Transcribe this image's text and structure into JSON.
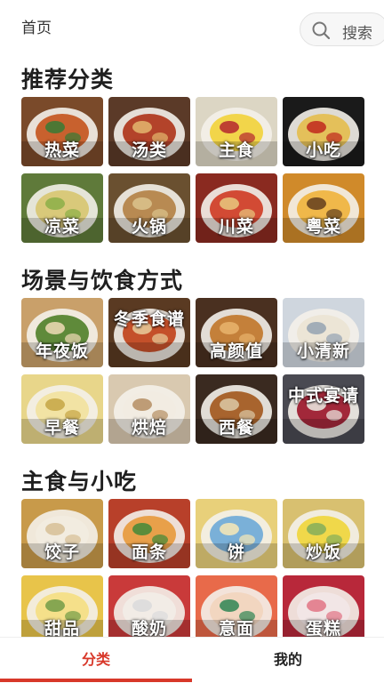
{
  "header": {
    "home_label": "首页",
    "search_label": "搜索",
    "search_icon": "search-icon"
  },
  "sections": [
    {
      "title": "推荐分类",
      "items": [
        {
          "label": "热菜",
          "colors": [
            "#7a4a2a",
            "#c8612e",
            "#3f7a35"
          ]
        },
        {
          "label": "汤类",
          "colors": [
            "#5b3a28",
            "#b3432a",
            "#e0b06a"
          ]
        },
        {
          "label": "主食",
          "colors": [
            "#dcd6c4",
            "#f2d54a",
            "#b83030"
          ]
        },
        {
          "label": "小吃",
          "colors": [
            "#1a1a1a",
            "#e4c05a",
            "#c23020"
          ]
        },
        {
          "label": "凉菜",
          "colors": [
            "#5f7a3a",
            "#d9c97a",
            "#8fb04a"
          ]
        },
        {
          "label": "火锅",
          "colors": [
            "#6a5030",
            "#b88a52",
            "#d9c089"
          ]
        },
        {
          "label": "川菜",
          "colors": [
            "#8a2a20",
            "#d24a34",
            "#e7c27a"
          ]
        },
        {
          "label": "粤菜",
          "colors": [
            "#d08a2a",
            "#f0b84a",
            "#6a4520"
          ]
        }
      ]
    },
    {
      "title": "场景与饮食方式",
      "items": [
        {
          "label": "年夜饭",
          "colors": [
            "#c9a06a",
            "#5f8a3a",
            "#e8d6b0"
          ]
        },
        {
          "label": "冬季食谱",
          "colors": [
            "#5a3a22",
            "#c4502a",
            "#e7c796"
          ]
        },
        {
          "label": "高颜值",
          "colors": [
            "#4a3020",
            "#c4803a",
            "#e7b06a"
          ]
        },
        {
          "label": "小清新",
          "colors": [
            "#cfd6de",
            "#ece5d6",
            "#9aa6b4"
          ]
        },
        {
          "label": "早餐",
          "colors": [
            "#e8d68a",
            "#f2e3a4",
            "#c8a84a"
          ]
        },
        {
          "label": "烘焙",
          "colors": [
            "#d9c9b0",
            "#f2ece2",
            "#b8946a"
          ]
        },
        {
          "label": "西餐",
          "colors": [
            "#3a2a20",
            "#a8642e",
            "#d8c3a0"
          ]
        },
        {
          "label": "中式宴请",
          "colors": [
            "#4a4a52",
            "#a2283a",
            "#e8e2dc"
          ]
        }
      ]
    },
    {
      "title": "主食与小吃",
      "items": [
        {
          "label": "饺子",
          "colors": [
            "#c89a4a",
            "#f2ece0",
            "#d8c29a"
          ]
        },
        {
          "label": "面条",
          "colors": [
            "#b8402a",
            "#e8a04a",
            "#4a8a3a"
          ]
        },
        {
          "label": "饼",
          "colors": [
            "#e8d07a",
            "#7ab0d8",
            "#f2e6b8"
          ]
        },
        {
          "label": "炒饭",
          "colors": [
            "#d8c070",
            "#f0d84a",
            "#8ab05a"
          ]
        },
        {
          "label": "甜品",
          "colors": [
            "#e8c44a",
            "#f5e08a",
            "#7aa04a"
          ]
        },
        {
          "label": "酸奶",
          "colors": [
            "#c93a3a",
            "#f2ece6",
            "#dcdcdc"
          ]
        },
        {
          "label": "意面",
          "colors": [
            "#e86a4a",
            "#f2d6c0",
            "#3a8a5a"
          ]
        },
        {
          "label": "蛋糕",
          "colors": [
            "#b8283a",
            "#f2e6e6",
            "#e27a8a"
          ]
        }
      ]
    }
  ],
  "tabbar": {
    "tabs": [
      {
        "label": "分类",
        "active": true
      },
      {
        "label": "我的",
        "active": false
      }
    ]
  },
  "accent_color": "#d8382a"
}
